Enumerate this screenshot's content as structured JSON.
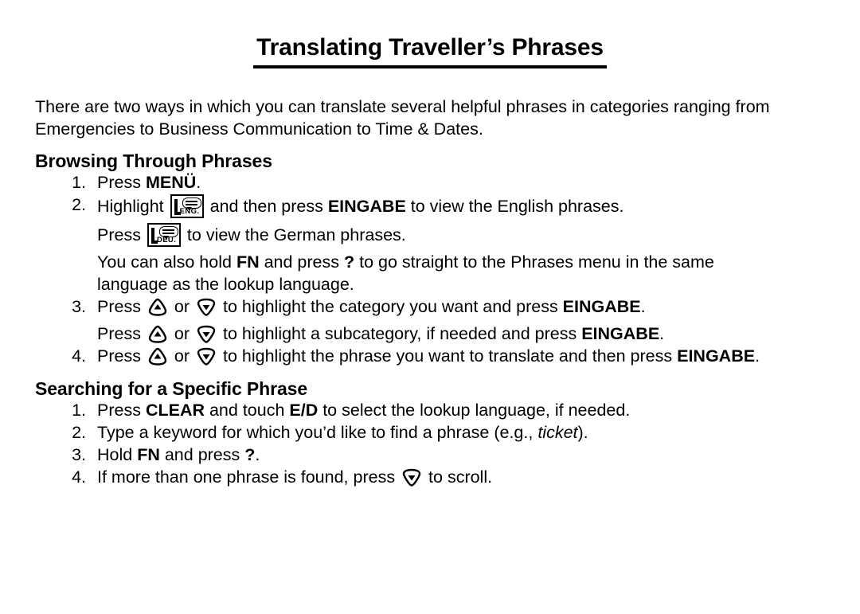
{
  "document": {
    "title": "Translating Traveller’s Phrases",
    "intro": "There are two ways in which you can translate several helpful phrases in categories ranging from Emergencies to Business Communication to Time & Dates."
  },
  "sections": [
    {
      "heading": "Browsing Through Phrases",
      "steps": [
        {
          "number": "1.",
          "lines": [
            {
              "parts": [
                {
                  "text": "Press "
                },
                {
                  "text": "MENÜ",
                  "style": "bold"
                },
                {
                  "text": "."
                }
              ]
            }
          ]
        },
        {
          "number": "2.",
          "lines": [
            {
              "parts": [
                {
                  "text": "Highlight "
                },
                {
                  "icon": "key-icon-eng",
                  "label": "ENG."
                },
                {
                  "text": " and then press "
                },
                {
                  "text": "EINGABE",
                  "style": "bold"
                },
                {
                  "text": " to view the English phrases."
                }
              ]
            },
            {
              "parts": [
                {
                  "text": "Press "
                },
                {
                  "icon": "key-icon-deu",
                  "label": "DEU."
                },
                {
                  "text": " to view the German phrases."
                }
              ]
            },
            {
              "parts": [
                {
                  "text": "You can also hold "
                },
                {
                  "text": "FN",
                  "style": "bold"
                },
                {
                  "text": " and press "
                },
                {
                  "text": "?",
                  "style": "bold"
                },
                {
                  "text": " to go straight to the Phrases menu in the same language as the lookup language."
                }
              ]
            }
          ]
        },
        {
          "number": "3.",
          "lines": [
            {
              "parts": [
                {
                  "text": "Press "
                },
                {
                  "icon": "up-arrow-key"
                },
                {
                  "text": " or "
                },
                {
                  "icon": "down-arrow-key"
                },
                {
                  "text": " to highlight the category you want and press "
                },
                {
                  "text": "EINGABE",
                  "style": "bold"
                },
                {
                  "text": "."
                }
              ]
            },
            {
              "parts": [
                {
                  "text": "Press "
                },
                {
                  "icon": "up-arrow-key"
                },
                {
                  "text": " or "
                },
                {
                  "icon": "down-arrow-key"
                },
                {
                  "text": " to highlight a subcategory, if needed and press "
                },
                {
                  "text": "EINGABE",
                  "style": "bold"
                },
                {
                  "text": "."
                }
              ]
            }
          ]
        },
        {
          "number": "4.",
          "lines": [
            {
              "parts": [
                {
                  "text": "Press "
                },
                {
                  "icon": "up-arrow-key"
                },
                {
                  "text": " or "
                },
                {
                  "icon": "down-arrow-key"
                },
                {
                  "text": " to highlight the phrase you want to translate and then press "
                },
                {
                  "text": "EINGABE",
                  "style": "bold"
                },
                {
                  "text": "."
                }
              ]
            }
          ]
        }
      ]
    },
    {
      "heading": "Searching for a Specific Phrase",
      "steps": [
        {
          "number": "1.",
          "lines": [
            {
              "parts": [
                {
                  "text": "Press "
                },
                {
                  "text": "CLEAR",
                  "style": "bold"
                },
                {
                  "text": " and touch "
                },
                {
                  "text": "E/D",
                  "style": "bold"
                },
                {
                  "text": " to select the lookup language, if needed."
                }
              ]
            }
          ]
        },
        {
          "number": "2.",
          "lines": [
            {
              "parts": [
                {
                  "text": "Type a keyword for which you’d like to find a phrase (e.g., "
                },
                {
                  "text": "ticket",
                  "style": "italic"
                },
                {
                  "text": ")."
                }
              ]
            }
          ]
        },
        {
          "number": "3.",
          "lines": [
            {
              "parts": [
                {
                  "text": "Hold "
                },
                {
                  "text": "FN",
                  "style": "bold"
                },
                {
                  "text": " and press "
                },
                {
                  "text": "?",
                  "style": "bold"
                },
                {
                  "text": "."
                }
              ]
            }
          ]
        },
        {
          "number": "4.",
          "lines": [
            {
              "parts": [
                {
                  "text": "If more than one phrase is found, press "
                },
                {
                  "icon": "down-arrow-key"
                },
                {
                  "text": " to scroll."
                }
              ]
            }
          ]
        }
      ]
    }
  ],
  "colors": {
    "text": "#000000",
    "background": "#ffffff"
  }
}
